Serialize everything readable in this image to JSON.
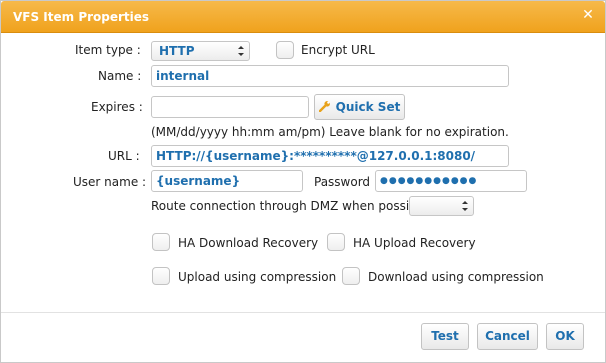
{
  "window": {
    "title": "VFS Item Properties",
    "close_icon": "close-icon"
  },
  "colors": {
    "titlebar": "#f0a21d",
    "accent_text": "#1f6fae"
  },
  "fields": {
    "item_type": {
      "label": "Item type :",
      "value": "HTTP"
    },
    "encrypt_url": {
      "label": "Encrypt URL",
      "checked": false
    },
    "name": {
      "label": "Name :",
      "value": "internal"
    },
    "expires": {
      "label": "Expires :",
      "value": "",
      "hint": "(MM/dd/yyyy hh:mm am/pm) Leave blank for no expiration.",
      "quick_set_label": "Quick Set",
      "quick_set_icon": "wrench-icon"
    },
    "url": {
      "label": "URL :",
      "value": "HTTP://{username}:**********@127.0.0.1:8080/"
    },
    "user_name": {
      "label": "User name :",
      "value": "{username}"
    },
    "password": {
      "label": "Password :",
      "value": "●●●●●●●●●●●"
    },
    "dmz": {
      "label": "Route connection through DMZ when possible :",
      "value": ""
    }
  },
  "options": {
    "ha_download": {
      "label": "HA Download Recovery",
      "checked": false
    },
    "ha_upload": {
      "label": "HA Upload Recovery",
      "checked": false
    },
    "upload_compression": {
      "label": "Upload using compression",
      "checked": false
    },
    "download_compression": {
      "label": "Download using compression",
      "checked": false
    }
  },
  "buttons": {
    "test": "Test",
    "cancel": "Cancel",
    "ok": "OK"
  }
}
